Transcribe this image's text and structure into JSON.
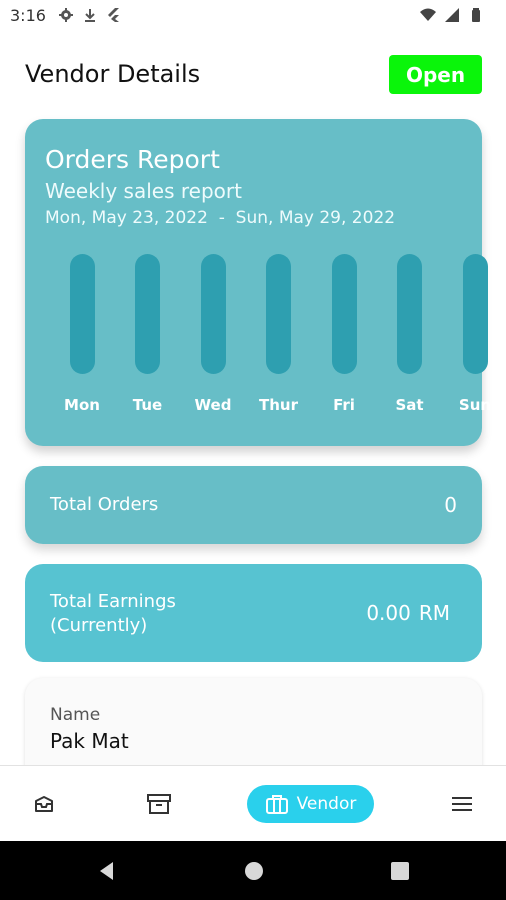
{
  "status_bar": {
    "time": "3:16",
    "left_icons": [
      "gear-icon",
      "download-icon",
      "flutter-icon"
    ],
    "right_icons": [
      "wifi-icon",
      "signal-icon",
      "battery-icon"
    ]
  },
  "header": {
    "title": "Vendor Details",
    "status_button": "Open",
    "status_color": "#0af50a"
  },
  "report": {
    "title": "Orders Report",
    "subtitle": "Weekly sales report",
    "range_start": "Mon, May 23, 2022",
    "range_separator": "-",
    "range_end": "Sun, May 29, 2022",
    "card_color": "#67bec7",
    "bar_color": "#2e9fb0"
  },
  "chart_data": {
    "type": "bar",
    "categories": [
      "Mon",
      "Tue",
      "Wed",
      "Thur",
      "Fri",
      "Sat",
      "Sun"
    ],
    "values": [
      0,
      0,
      0,
      0,
      0,
      0,
      0
    ],
    "title": "Orders Report",
    "xlabel": "",
    "ylabel": "",
    "grid": false
  },
  "orders": {
    "label": "Total Orders",
    "value": "0"
  },
  "earnings": {
    "label_line1": "Total Earnings",
    "label_line2": "(Currently)",
    "amount": "0.00",
    "currency": "RM",
    "card_color": "#57c3d1"
  },
  "vendor_info": {
    "name_label": "Name",
    "name_value": "Pak Mat"
  },
  "bottom_nav": {
    "items": [
      {
        "icon": "orders-inbox-icon",
        "label": ""
      },
      {
        "icon": "archive-icon",
        "label": ""
      },
      {
        "icon": "vendor-briefcase-icon",
        "label": "Vendor",
        "active": true
      },
      {
        "icon": "menu-icon",
        "label": ""
      }
    ],
    "active_color": "#2ad0ec"
  },
  "system_nav": {
    "icons": [
      "back-icon",
      "home-icon",
      "recents-icon"
    ]
  }
}
